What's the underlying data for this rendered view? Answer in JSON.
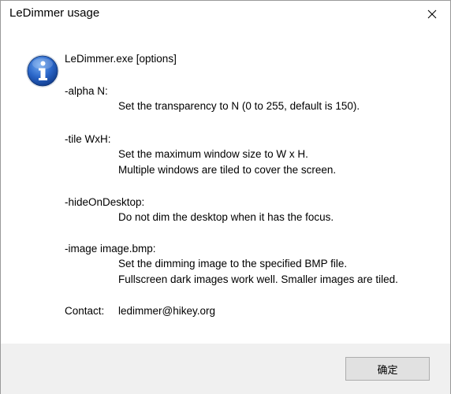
{
  "window": {
    "title": "LeDimmer usage"
  },
  "icons": {
    "close": "close-icon",
    "info": "info-icon"
  },
  "usage": {
    "command": "LeDimmer.exe [options]",
    "options": [
      {
        "flag": "-alpha N:",
        "lines": [
          "Set the transparency to N (0 to 255, default is 150)."
        ]
      },
      {
        "flag": "-tile WxH:",
        "lines": [
          "Set the maximum window size to W x H.",
          "Multiple windows are tiled to cover the screen."
        ]
      },
      {
        "flag": "-hideOnDesktop:",
        "lines": [
          "Do not dim the desktop when it has the focus."
        ]
      },
      {
        "flag": "-image image.bmp:",
        "lines": [
          "Set the dimming image to the specified BMP file.",
          "Fullscreen dark images work well. Smaller images are tiled."
        ]
      }
    ],
    "contact_label": "Contact:",
    "contact_value": "ledimmer@hikey.org"
  },
  "footer": {
    "ok_label": "确定"
  },
  "colors": {
    "footer_bg": "#f0f0f0",
    "button_bg": "#e1e1e1",
    "button_border": "#adadad",
    "icon_blue": "#1b5fc4"
  }
}
